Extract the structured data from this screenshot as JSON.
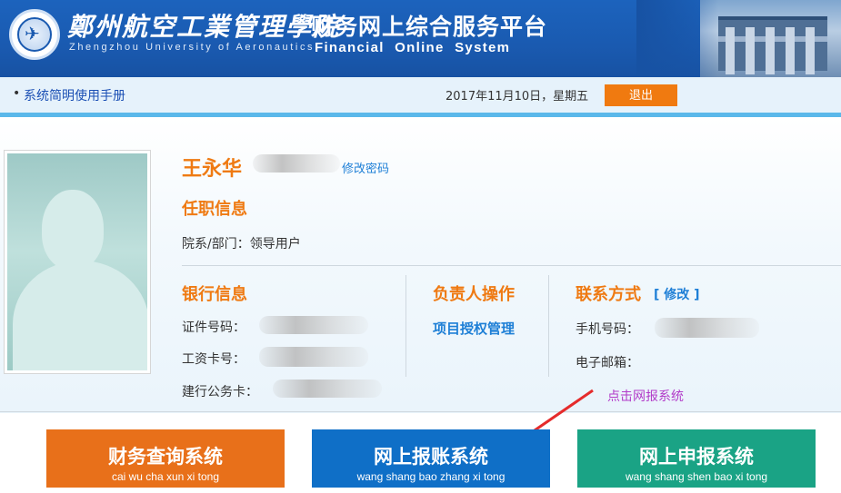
{
  "header": {
    "university_cn": "鄭州航空工業管理學院",
    "university_en": "Zhengzhou University of Aeronautics",
    "platform_cn": "财务网上综合服务平台",
    "platform_en": "Financial Online System",
    "logo_icon": "university-seal-icon",
    "photo": "campus-building-photo"
  },
  "toolbar": {
    "manual_link": "系统简明使用手册",
    "date": "2017年11月10日，星期五",
    "logout_label": "退出"
  },
  "profile": {
    "name": "王永华",
    "change_password": "修改密码",
    "job_info_title": "任职信息",
    "department_line": "院系/部门：领导用户",
    "bank_info_title": "银行信息",
    "id_number_label": "证件号码：",
    "salary_card_label": "工资卡号：",
    "ccb_card_label": "建行公务卡：",
    "manager_title": "负责人操作",
    "project_auth_link": "项目授权管理",
    "contact_title": "联系方式",
    "contact_modify": "[ 修改 ]",
    "phone_label": "手机号码：",
    "email_label": "电子邮箱："
  },
  "annotation": {
    "hint": "点击网报系统"
  },
  "systems": [
    {
      "cn": "财务查询系统",
      "pinyin": "cai wu cha xun xi tong",
      "color": "#e8701a"
    },
    {
      "cn": "网上报账系统",
      "pinyin": "wang shang bao zhang xi tong",
      "color": "#0f6fc7"
    },
    {
      "cn": "网上申报系统",
      "pinyin": "wang shang shen bao xi tong",
      "color": "#1aa385"
    }
  ],
  "colors": {
    "header_blue": "#1a5ab0",
    "accent_orange": "#ef7a12",
    "link_blue": "#1e7fd6",
    "hint_purple": "#b23cc9",
    "arrow_red": "#e52b2b"
  }
}
